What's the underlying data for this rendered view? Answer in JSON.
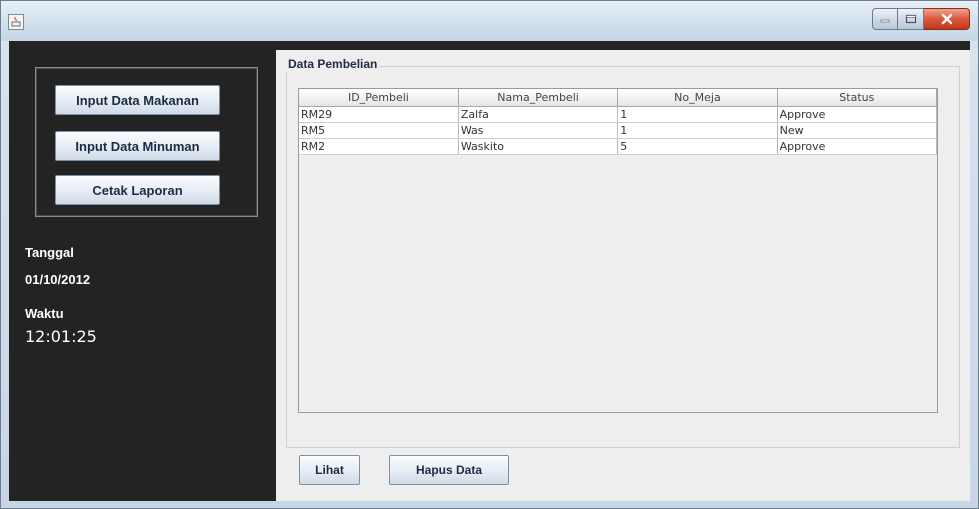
{
  "window": {
    "icon": "java-app-icon",
    "controls": [
      "minimize-icon",
      "maximize-icon",
      "close-icon"
    ],
    "close_color": "#d9583a"
  },
  "sidebar": {
    "buttons": [
      {
        "label": "Input Data Makanan"
      },
      {
        "label": "Input Data Minuman"
      },
      {
        "label": "Cetak Laporan"
      }
    ],
    "date_label": "Tanggal",
    "date_value": "01/10/2012",
    "time_label": "Waktu",
    "time_value": "12:01:25"
  },
  "panel": {
    "title": "Data Pembelian",
    "table": {
      "columns": [
        "ID_Pembeli",
        "Nama_Pembeli",
        "No_Meja",
        "Status"
      ],
      "rows": [
        [
          "RM29",
          "Zalfa",
          "1",
          "Approve"
        ],
        [
          "RM5",
          "Was",
          "1",
          "New"
        ],
        [
          "RM2",
          "Waskito",
          "5",
          "Approve"
        ]
      ]
    },
    "buttons": {
      "lihat": "Lihat",
      "hapus": "Hapus Data"
    }
  }
}
